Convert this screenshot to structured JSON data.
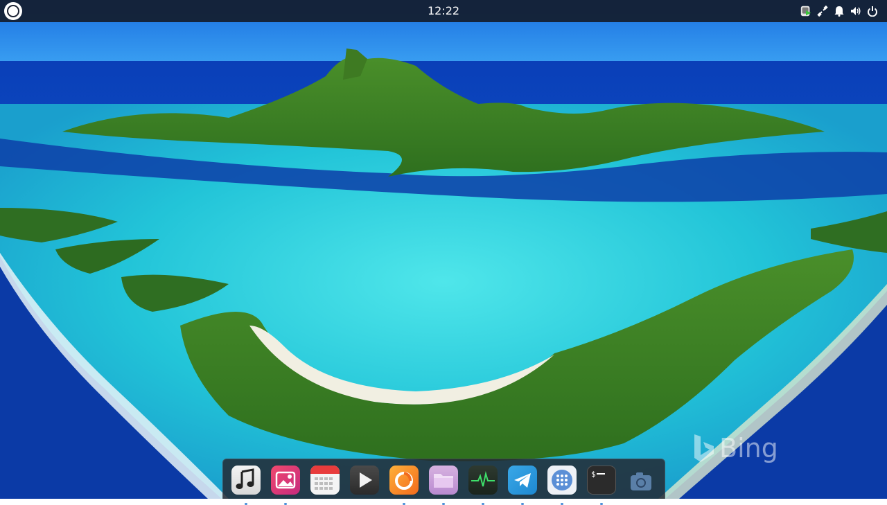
{
  "topbar": {
    "time": "12:22"
  },
  "tray": {
    "icons": [
      "app-indicator-icon",
      "network-icon",
      "notification-bell-icon",
      "volume-icon",
      "power-icon"
    ]
  },
  "wallpaper": {
    "watermark": "Bing"
  },
  "dock": {
    "items": [
      {
        "name": "music-app",
        "icon": "music-note-icon"
      },
      {
        "name": "photos-app",
        "icon": "photo-icon"
      },
      {
        "name": "calendar-app",
        "icon": "calendar-icon"
      },
      {
        "name": "video-player-app",
        "icon": "play-icon"
      },
      {
        "name": "firefox-app",
        "icon": "firefox-icon"
      },
      {
        "name": "files-app",
        "icon": "folder-icon"
      },
      {
        "name": "system-monitor-app",
        "icon": "activity-icon"
      },
      {
        "name": "telegram-app",
        "icon": "telegram-icon"
      },
      {
        "name": "app-grid",
        "icon": "grid-icon"
      },
      {
        "name": "terminal-app",
        "icon": "terminal-icon"
      },
      {
        "name": "screenshot-app",
        "icon": "camera-icon"
      }
    ]
  },
  "colors": {
    "accent": "#4a90d9",
    "topbar": "#141c2d"
  }
}
